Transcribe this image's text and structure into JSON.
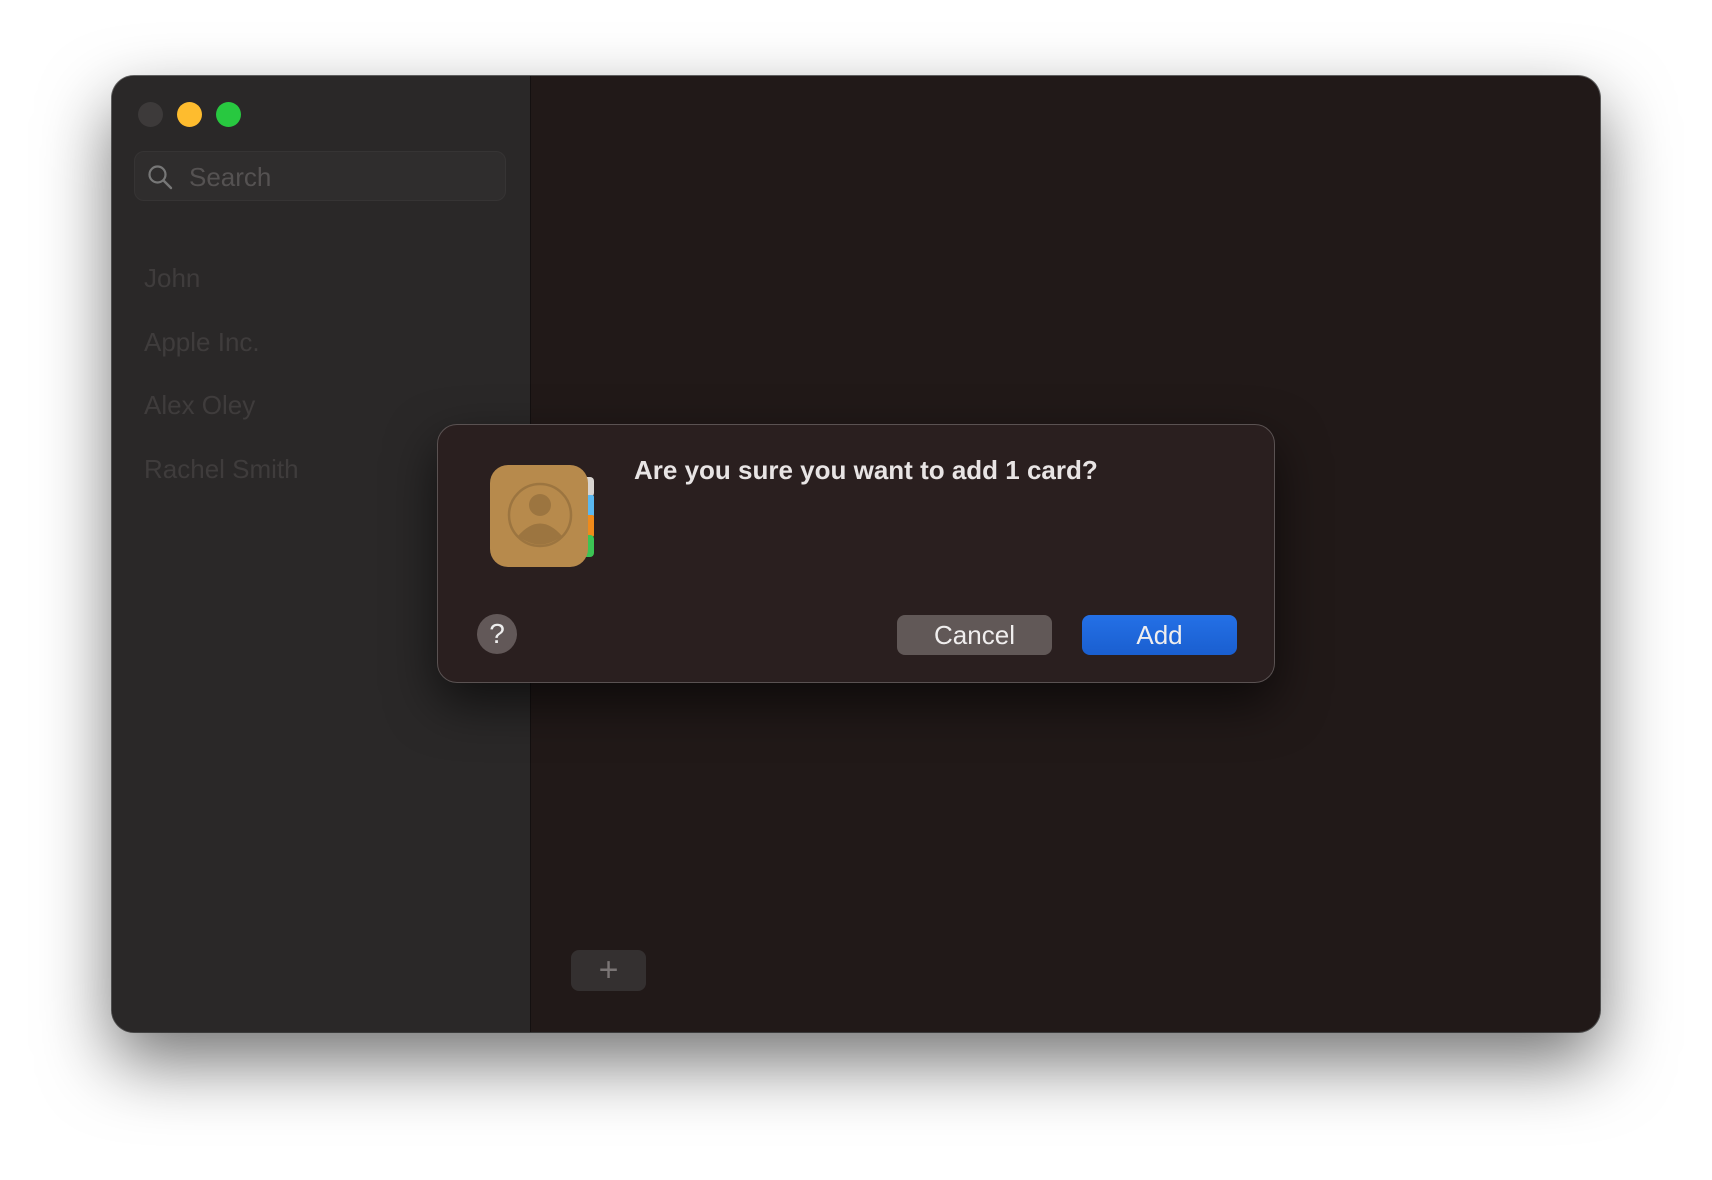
{
  "window": {
    "traffic_lights": [
      {
        "name": "close",
        "color": "#3d3a3a"
      },
      {
        "name": "minimize",
        "color": "#febc2e"
      },
      {
        "name": "zoom",
        "color": "#28c840"
      }
    ]
  },
  "sidebar": {
    "search": {
      "placeholder": "Search",
      "value": "",
      "icon": "search-icon"
    },
    "contacts": [
      "John",
      "Apple Inc.",
      "Alex Oley",
      "Rachel Smith"
    ]
  },
  "main": {
    "add_button_label": "+"
  },
  "dialog": {
    "icon": "contacts-app-icon",
    "message": "Are you sure you want to add 1 card?",
    "help_label": "?",
    "cancel_label": "Cancel",
    "add_label": "Add",
    "accent_color": "#1f68de"
  }
}
